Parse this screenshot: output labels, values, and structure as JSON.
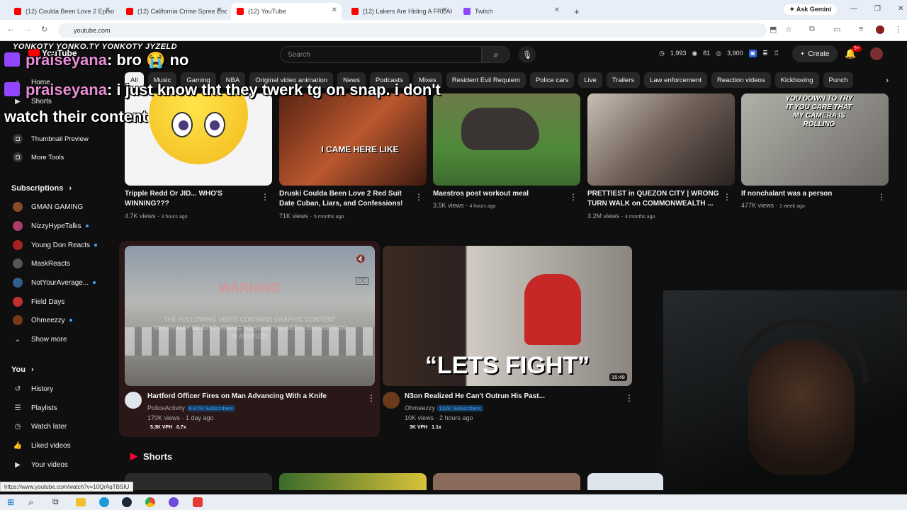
{
  "browser": {
    "tabs": [
      {
        "label": "(12) Coulda Been Love 2 Episo",
        "color": "#ff0000"
      },
      {
        "label": "(12) California Crime Spree Enc",
        "color": "#ff0000"
      },
      {
        "label": "(12) YouTube",
        "color": "#ff0000",
        "active": true
      },
      {
        "label": "(12) Lakers Are Hiding A FREAK",
        "color": "#ff0000"
      },
      {
        "label": "Twitch",
        "color": "#9146ff"
      }
    ],
    "new_tab": "+",
    "ask_gemini": "Ask Gemini",
    "url": "youtube.com",
    "status_url": "https://www.youtube.com/watch?v=10QrAqTBSIU"
  },
  "youtube": {
    "logo": "YouTube",
    "search_placeholder": "Search",
    "stats": {
      "a": "1,993",
      "b": "81",
      "c": "3,900"
    },
    "create_label": "Create",
    "notif_count": "9+",
    "chips": [
      "All",
      "Music",
      "Gaming",
      "NBA",
      "Original video animation",
      "News",
      "Podcasts",
      "Mixes",
      "Resident Evil Requiem",
      "Police cars",
      "Live",
      "Trailers",
      "Law enforcement",
      "Reaction videos",
      "Kickboxing",
      "Punch"
    ],
    "sidebar_top": [
      "Home",
      "Shorts",
      "Subscriptions",
      "Thumbnail Preview",
      "More Tools"
    ],
    "subscriptions_heading": "Subscriptions",
    "subscriptions": [
      {
        "name": "GMAN GAMING",
        "live": false
      },
      {
        "name": "NizzyHypeTalks",
        "live": true
      },
      {
        "name": "Young Don Reacts",
        "live": true
      },
      {
        "name": "MaskReacts",
        "live": false
      },
      {
        "name": "NotYourAverage...",
        "live": true
      },
      {
        "name": "Field Days",
        "live": false
      },
      {
        "name": "Ohmeezzy",
        "live": true
      }
    ],
    "show_more": "Show more",
    "you_heading": "You",
    "you_items": [
      "History",
      "Playlists",
      "Watch later",
      "Liked videos",
      "Your videos"
    ],
    "row1": [
      {
        "title": "Tripple Redd Or JID... WHO'S WINNING???",
        "views": "4.7K views",
        "age": "3 hours ago"
      },
      {
        "title": "Druski Coulda Been Love 2 Red Suit Date  Cuban, Liars, and Confessions!",
        "views": "71K views",
        "age": "5 months ago",
        "thumb_text_a": "I CAME",
        "thumb_text_b": "HERE LIKE"
      },
      {
        "title": "Maestros post workout meal",
        "views": "3.5K views",
        "age": "4 hours ago"
      },
      {
        "title": "PRETTIEST in QUEZON CITY | WRONG TURN WALK on COMMONWEALTH ...",
        "views": "3.2M views",
        "age": "4 months ago"
      },
      {
        "title": "If nonchalant was a person",
        "views": "477K views",
        "age": "1 week ago",
        "thumb_text": "YOU DOWN TO TRY IT YOU CARE THAT MY CAMERA IS ROLLING"
      }
    ],
    "row2": [
      {
        "title": "Hartford Officer Fires on Man Advancing With a Knife",
        "channel": "PoliceActivity",
        "subs": "6.87M Subscribers",
        "views": "170K views",
        "age": "1 day ago",
        "vph": "5.3K VPH",
        "ratio": "0.7x",
        "warning": "WARNING",
        "warning_body": "THE FOLLOWING VIDEO CONTAINS GRAPHIC CONTENT WHICH MAY BE DISTURBING TO SOME VIEWERS. DISCRETION IS ADVISED."
      },
      {
        "title": "N3on Realized He Can't Outrun His Past...",
        "channel": "Ohmeezzy",
        "subs": "132K Subscribers",
        "views": "10K views",
        "age": "2 hours ago",
        "vph": "3K VPH",
        "ratio": "1.1x",
        "thumb_text": "“LETS FIGHT”",
        "duration": "15:49"
      }
    ],
    "shorts_heading": "Shorts"
  },
  "overlay": {
    "socials": "YONKOTY  YONKO.TY  YONKOTY  JYZELD",
    "chat": [
      {
        "name": "praiseyana",
        "message": ": bro 😭 no"
      },
      {
        "name": "praiseyana",
        "message": ": i just know tht they twerk tg on snap. i don't"
      },
      {
        "name": "",
        "message": "watch their content"
      }
    ]
  }
}
